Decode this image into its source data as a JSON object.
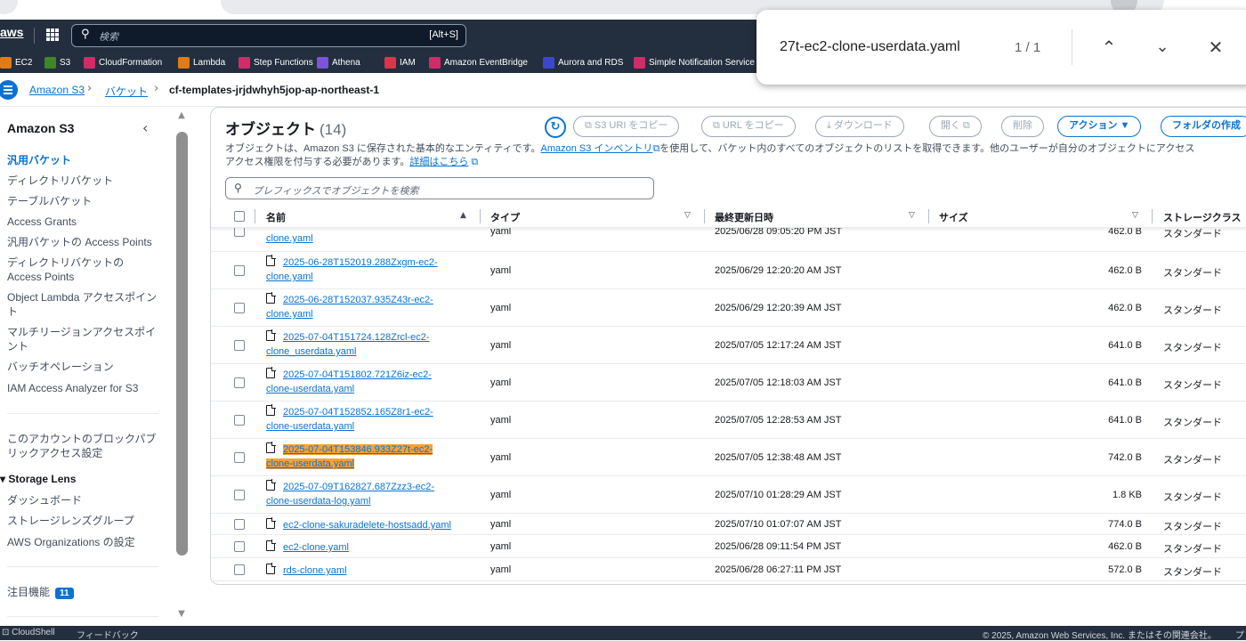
{
  "topnav": {
    "logo": "aws",
    "search_placeholder": "検索",
    "search_shortcut": "[Alt+S]"
  },
  "favorites": [
    {
      "label": "EC2",
      "icon": "ec2-icon",
      "color": "#e07b15"
    },
    {
      "label": "S3",
      "icon": "s3-icon",
      "color": "#3f8624"
    },
    {
      "label": "CloudFormation",
      "icon": "cloudformation-icon",
      "color": "#d12c6a"
    },
    {
      "label": "Lambda",
      "icon": "lambda-icon",
      "color": "#e07b15"
    },
    {
      "label": "Step Functions",
      "icon": "step-functions-icon",
      "color": "#d12c6a"
    },
    {
      "label": "Athena",
      "icon": "athena-icon",
      "color": "#7a55d8"
    },
    {
      "label": "IAM",
      "icon": "iam-icon",
      "color": "#dd344c"
    },
    {
      "label": "Amazon EventBridge",
      "icon": "eventbridge-icon",
      "color": "#d12c6a"
    },
    {
      "label": "Aurora and RDS",
      "icon": "rds-icon",
      "color": "#3b48cc"
    },
    {
      "label": "Simple Notification Service",
      "icon": "sns-icon",
      "color": "#d12c6a"
    }
  ],
  "find_bar": {
    "query": "27t-ec2-clone-userdata.yaml",
    "count": "1 / 1"
  },
  "breadcrumb": {
    "items": [
      "Amazon S3",
      "バケット"
    ],
    "current": "cf-templates-jrjdwhyh5jop-ap-northeast-1"
  },
  "sidebar": {
    "title": "Amazon S3",
    "items": [
      {
        "label": "汎用バケット",
        "active": true
      },
      {
        "label": "ディレクトリバケット"
      },
      {
        "label": "テーブルバケット"
      },
      {
        "label": "Access Grants"
      },
      {
        "label": "汎用バケットの Access Points"
      },
      {
        "label": "ディレクトリバケットの Access Points"
      },
      {
        "label": "Object Lambda アクセスポイント"
      },
      {
        "label": "マルチリージョンアクセスポイント"
      },
      {
        "label": "バッチオペレーション"
      },
      {
        "label": "IAM Access Analyzer for S3"
      }
    ],
    "block_public": "このアカウントのブロックパブリックアクセス設定",
    "storage_lens": {
      "title": "Storage Lens",
      "items": [
        "ダッシュボード",
        "ストレージレンズグループ",
        "AWS Organizations の設定"
      ]
    },
    "featured": "注目機能",
    "featured_badge": "11"
  },
  "objects": {
    "title": "オブジェクト",
    "count": "(14)",
    "buttons": {
      "copy_s3_uri": "S3 URI をコピー",
      "copy_url": "URL をコピー",
      "download": "ダウンロード",
      "open": "開く",
      "delete": "削除",
      "actions": "アクション ▼",
      "create_folder": "フォルダの作成"
    },
    "description_1": "オブジェクトは、Amazon S3 に保存された基本的なエンティティです。",
    "inventory_link": "Amazon S3 インベントリ",
    "description_2": "を使用して、バケット内のすべてのオブジェクトのリストを取得できます。他のユーザーが自分のオブジェクトにアクセス",
    "description_3": "アクセス権限を付与する必要があります。",
    "learn_more": "詳細はこちら",
    "search_placeholder": "プレフィックスでオブジェクトを検索",
    "columns": {
      "name": "名前",
      "type": "タイプ",
      "modified": "最終更新日時",
      "size": "サイズ",
      "storage": "ストレージクラス"
    },
    "rows": [
      {
        "name1": "",
        "name2": "clone.yaml",
        "type": "yaml",
        "modified": "2025/06/28 09:05:20 PM JST",
        "size": "462.0 B",
        "storage": "スタンダード"
      },
      {
        "name1": "2025-06-28T152019.288Zxgm-ec2-",
        "name2": "clone.yaml",
        "type": "yaml",
        "modified": "2025/06/29 12:20:20 AM JST",
        "size": "462.0 B",
        "storage": "スタンダード"
      },
      {
        "name1": "2025-06-28T152037.935Z43r-ec2-",
        "name2": "clone.yaml",
        "type": "yaml",
        "modified": "2025/06/29 12:20:39 AM JST",
        "size": "462.0 B",
        "storage": "スタンダード"
      },
      {
        "name1": "2025-07-04T151724.128Zrcl-ec2-",
        "name2": "clone_userdata.yaml",
        "type": "yaml",
        "modified": "2025/07/05 12:17:24 AM JST",
        "size": "641.0 B",
        "storage": "スタンダード"
      },
      {
        "name1": "2025-07-04T151802.721Z6iz-ec2-",
        "name2": "clone-userdata.yaml",
        "type": "yaml",
        "modified": "2025/07/05 12:18:03 AM JST",
        "size": "641.0 B",
        "storage": "スタンダード"
      },
      {
        "name1": "2025-07-04T152852.165Z8r1-ec2-",
        "name2": "clone-userdata.yaml",
        "type": "yaml",
        "modified": "2025/07/05 12:28:53 AM JST",
        "size": "641.0 B",
        "storage": "スタンダード"
      },
      {
        "name1": "2025-07-04T153846.933Z27t-ec2-",
        "name2": "clone-userdata.yaml",
        "type": "yaml",
        "modified": "2025/07/05 12:38:48 AM JST",
        "size": "742.0 B",
        "storage": "スタンダード",
        "highlight": true
      },
      {
        "name1": "2025-07-09T162827.687Zzz3-ec2-",
        "name2": "clone-userdata-log.yaml",
        "type": "yaml",
        "modified": "2025/07/10 01:28:29 AM JST",
        "size": "1.8 KB",
        "storage": "スタンダード"
      },
      {
        "name1": "ec2-clone-sakuradelete-hostsadd.yaml",
        "name2": "",
        "type": "yaml",
        "modified": "2025/07/10 01:07:07 AM JST",
        "size": "774.0 B",
        "storage": "スタンダード"
      },
      {
        "name1": "ec2-clone.yaml",
        "name2": "",
        "type": "yaml",
        "modified": "2025/06/28 09:11:54 PM JST",
        "size": "462.0 B",
        "storage": "スタンダード"
      },
      {
        "name1": "rds-clone.yaml",
        "name2": "",
        "type": "yaml",
        "modified": "2025/06/28 06:27:11 PM JST",
        "size": "572.0 B",
        "storage": "スタンダード"
      }
    ]
  },
  "footer": {
    "cloudshell": "CloudShell",
    "feedback": "フィードバック",
    "copyright": "© 2025, Amazon Web Services, Inc. またはその関連会社。",
    "right_extra": "プ"
  }
}
